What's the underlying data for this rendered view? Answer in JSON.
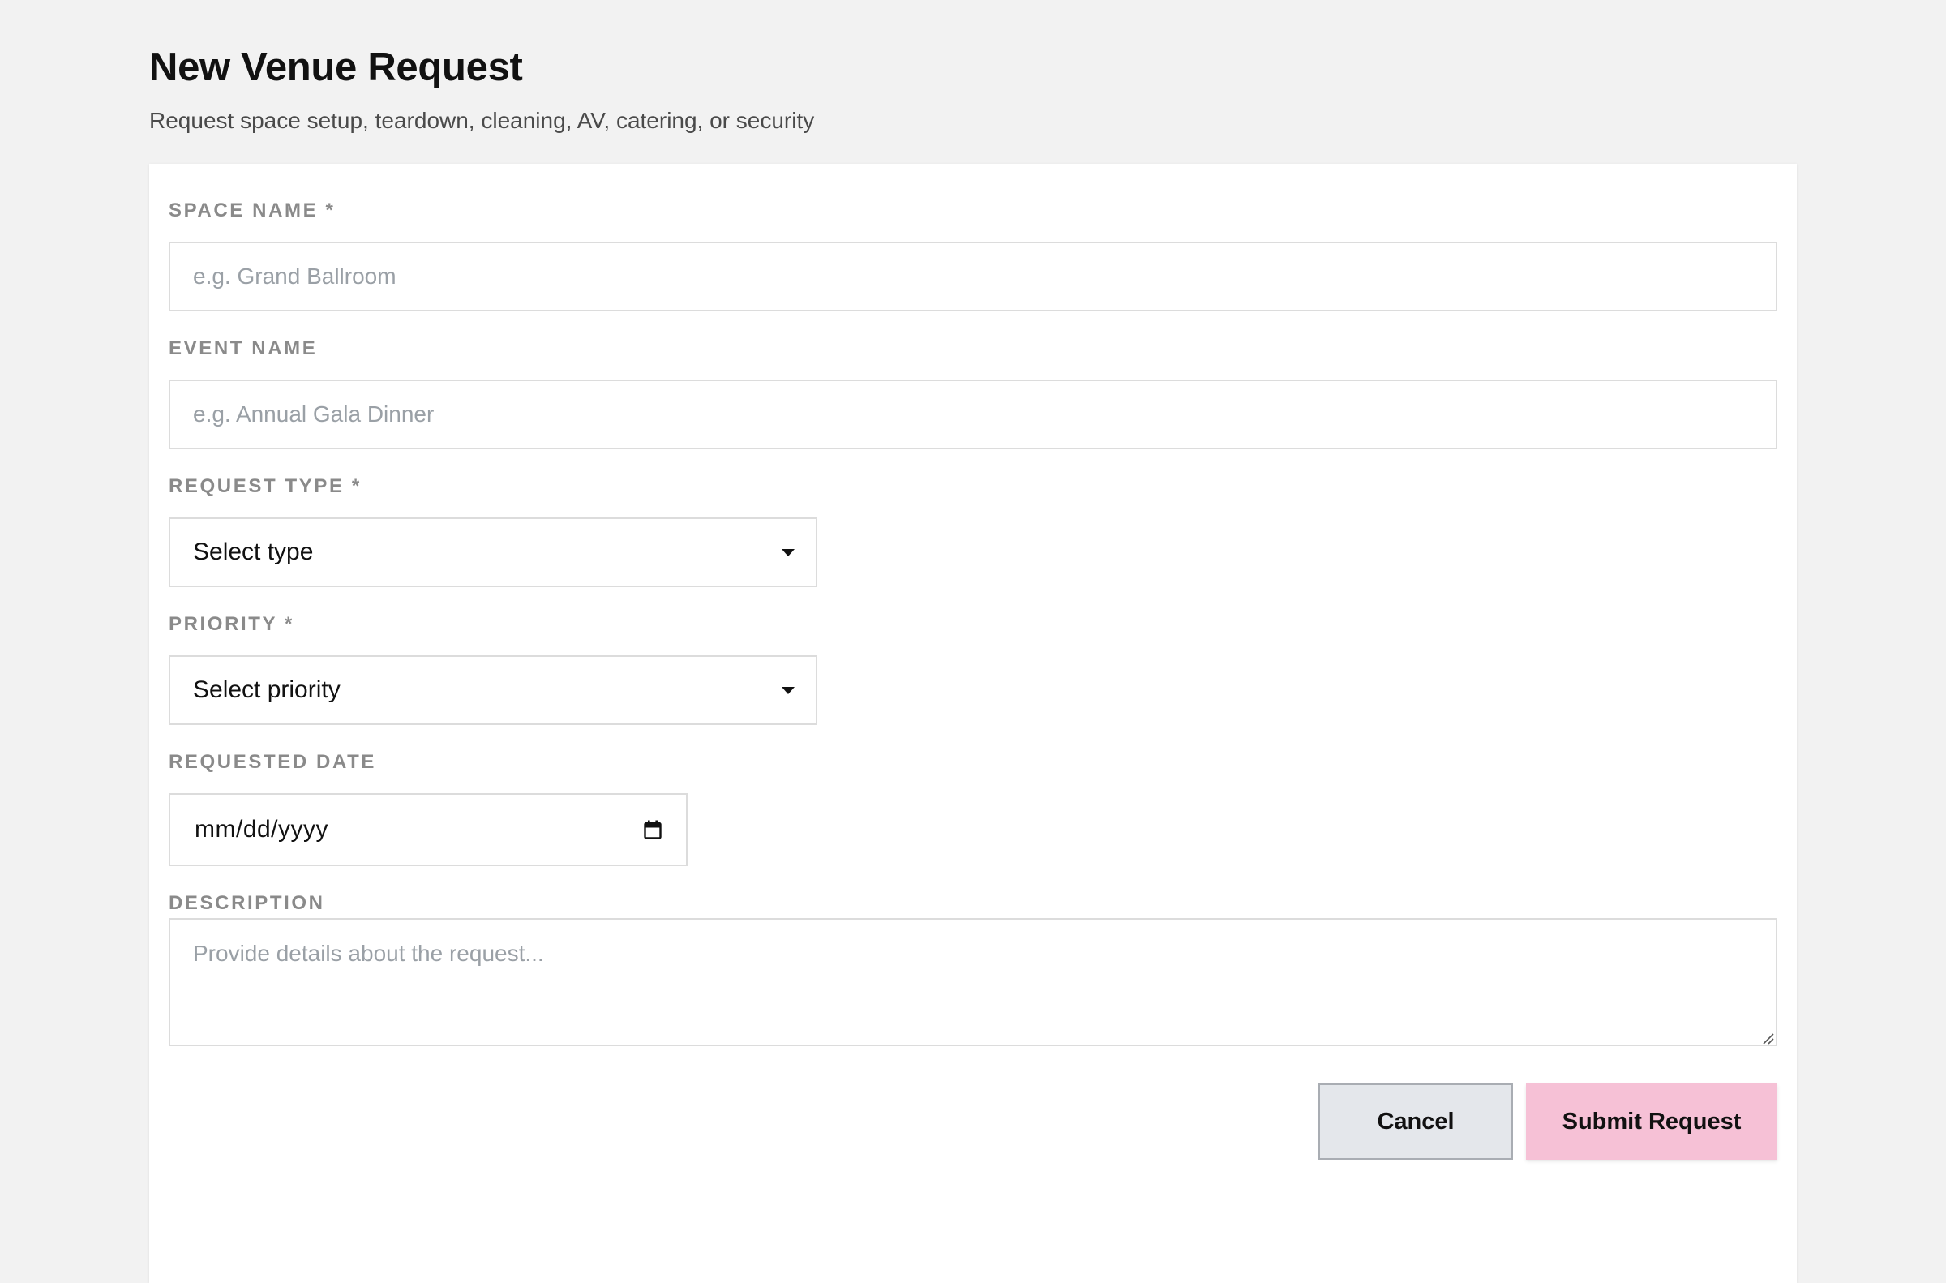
{
  "header": {
    "title": "New Venue Request",
    "subtitle": "Request space setup, teardown, cleaning, AV, catering, or security"
  },
  "form": {
    "space_name": {
      "label": "SPACE NAME *",
      "placeholder": "e.g. Grand Ballroom",
      "value": ""
    },
    "event_name": {
      "label": "EVENT NAME",
      "placeholder": "e.g. Annual Gala Dinner",
      "value": ""
    },
    "request_type": {
      "label": "REQUEST TYPE *",
      "selected": "Select type",
      "icon": "chevron-down-icon"
    },
    "priority": {
      "label": "PRIORITY *",
      "selected": "Select priority",
      "icon": "chevron-down-icon"
    },
    "requested_date": {
      "label": "REQUESTED DATE",
      "value": "mm/dd/yyyy",
      "icon": "calendar-icon"
    },
    "description": {
      "label": "DESCRIPTION",
      "placeholder": "Provide details about the request...",
      "value": ""
    }
  },
  "actions": {
    "cancel_label": "Cancel",
    "submit_label": "Submit Request"
  },
  "colors": {
    "page_background": "#f2f2f2",
    "card_background": "#ffffff",
    "submit_button": "#f6c1d6",
    "cancel_button": "#e4e7eb",
    "label_text": "#8a8a8a",
    "placeholder_text": "#9aa0a6"
  }
}
